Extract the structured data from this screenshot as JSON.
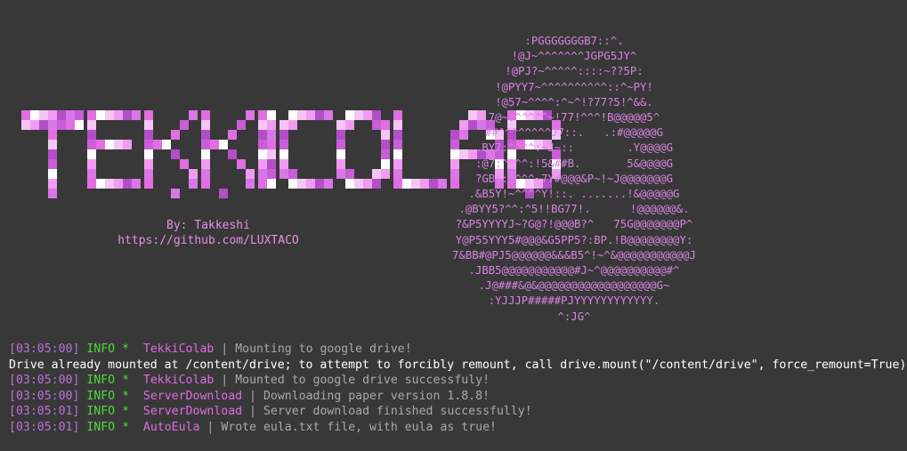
{
  "credits": {
    "by": "By: Takkeshi",
    "url": "https://github.com/LUXTACO"
  },
  "colors": {
    "background": "#383838",
    "accent_pink": "#e88ee8",
    "timestamp": "#ba72d8",
    "info_green": "#52d83e",
    "module_magenta": "#e06ce0",
    "message_gray": "#a9a9a9"
  },
  "ascii_art": [
    ":PGGGGGGGB7::^.",
    "!@J~^^^^^^^JGPG5JY^",
    "!@PJ?~^^^^^::::~??5P:",
    "!@PYY7~^^^^^^^^^^::^~PY!",
    "!@57~^^^^:^~^!?77?5!^&&.",
    "7@~:^^^^^~!77!^^^!B@@@@@5^",
    "##^^^^^^^^J7::.   .:#@@@@@G",
    ".BY7:^^^^:~J~::        .Y@@@@G",
    ":@7:^^^^:!5&##B.       5&@@@@G",
    "?GB!:^^^^~7Y#@@@&P~!~J@@@@@@@G",
    ".&B5Y!~^^^^Y!::. .......!&@@@@@G",
    ".@BYY5?^^:^5!!BG77!.      !@@@@@@&.",
    "?&P5YYYYJ~?G@?!@@@B?^   75G@@@@@@@P^",
    "Y@P55YYY5#@@@&G5PP5?:BP.!B@@@@@@@@Y:",
    "7&BB#@PJ5@@@@@@&&&B5^!~^&@@@@@@@@@@@J",
    ".JBB5@@@@@@@@@@@#J~^@@@@@@@@@@#^",
    ".J@###&@&@@@@@@@@@@@@@@@@@@G~",
    ":YJJJP#####PJYYYYYYYYYYYY.",
    "^:JG^"
  ],
  "log": [
    {
      "type": "info",
      "ts": "[03:05:00]",
      "level": "INFO",
      "star": "*",
      "source": "TekkiColab",
      "sep": "|",
      "message": "Mounting to google drive!"
    },
    {
      "type": "plain",
      "text": "Drive already mounted at /content/drive; to attempt to forcibly remount, call drive.mount(\"/content/drive\", force_remount=True)."
    },
    {
      "type": "info",
      "ts": "[03:05:00]",
      "level": "INFO",
      "star": "*",
      "source": "TekkiColab",
      "sep": "|",
      "message": "Mounted to google drive successfuly!"
    },
    {
      "type": "info",
      "ts": "[03:05:00]",
      "level": "INFO",
      "star": "*",
      "source": "ServerDownload",
      "sep": "|",
      "message": "Downloading paper version 1.8.8!"
    },
    {
      "type": "info",
      "ts": "[03:05:01]",
      "level": "INFO",
      "star": "*",
      "source": "ServerDownload",
      "sep": "|",
      "message": "Server download finished successfully!"
    },
    {
      "type": "info",
      "ts": "[03:05:01]",
      "level": "INFO",
      "star": "*",
      "source": "AutoEula",
      "sep": "|",
      "message": "Wrote eula.txt file, with eula as true!"
    }
  ]
}
